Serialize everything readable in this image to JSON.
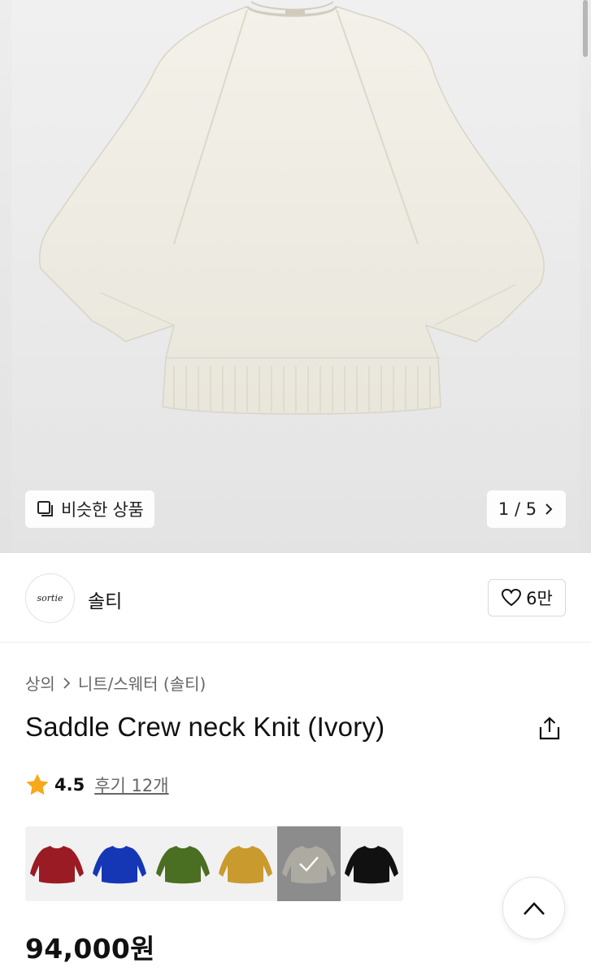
{
  "hero": {
    "image_alt": "sweater-image",
    "similar_label": "비슷한 상품",
    "pager_text": "1 / 5"
  },
  "brand": {
    "logo_text": "sortie",
    "name": "솔티",
    "like_count": "6만"
  },
  "breadcrumb": {
    "category": "상의",
    "subcategory": "니트/스웨터 (솔티)"
  },
  "product": {
    "title": "Saddle Crew neck Knit (Ivory)",
    "rating": "4.5",
    "reviews": "후기 12개",
    "price": "94,000원"
  },
  "swatches": [
    {
      "name": "red",
      "color": "#9b1b24",
      "selected": false
    },
    {
      "name": "blue",
      "color": "#1537b5",
      "selected": false
    },
    {
      "name": "green",
      "color": "#4a6e22",
      "selected": false
    },
    {
      "name": "mustard",
      "color": "#c99a2e",
      "selected": false
    },
    {
      "name": "ivory",
      "color": "#c9c3b5",
      "selected": true
    },
    {
      "name": "black",
      "color": "#111111",
      "selected": false
    }
  ],
  "colors": {
    "star": "#f6a91b",
    "sweater": "#efede4"
  },
  "icons": {
    "similar": "copy-square-icon",
    "pager": "chevron-right-icon",
    "like": "heart-icon",
    "share": "share-icon",
    "star": "star-icon",
    "top": "chevron-up-icon",
    "check": "check-icon"
  }
}
